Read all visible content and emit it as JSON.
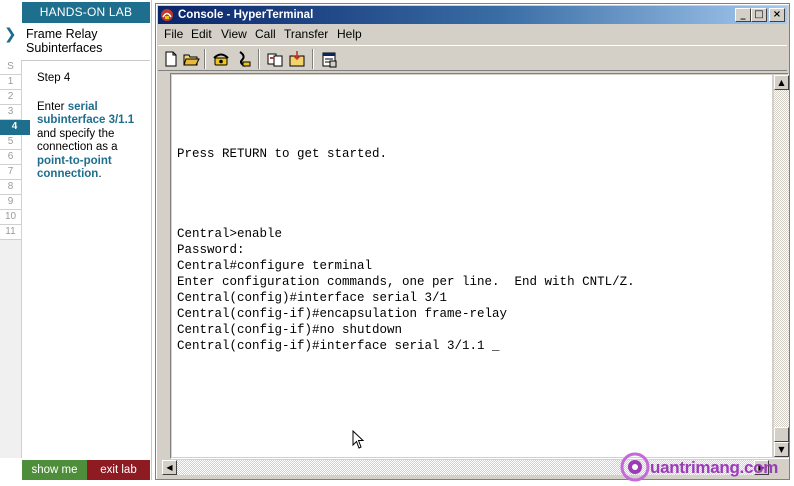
{
  "lab": {
    "header": "HANDS-ON LAB",
    "title": "Frame Relay Subinterfaces",
    "steps": [
      "S",
      "1",
      "2",
      "3",
      "4",
      "5",
      "6",
      "7",
      "8",
      "9",
      "10",
      "11"
    ],
    "active_step": "4",
    "step_label": "Step 4",
    "instruction": {
      "part1": "Enter ",
      "highlight1": "serial subinterface 3/1.1",
      "part2": " and specify the connection as a ",
      "highlight2": "point-to-point connection",
      "part3": "."
    },
    "buttons": {
      "show_me": "show me",
      "exit_lab": "exit lab"
    },
    "colors": {
      "accent": "#1e6e8e",
      "show_me": "#4e8e3a",
      "exit_lab": "#8e1a22"
    }
  },
  "window": {
    "title": "Console - HyperTerminal",
    "menu": [
      "File",
      "Edit",
      "View",
      "Call",
      "Transfer",
      "Help"
    ],
    "toolbar_icons": [
      "new-icon",
      "open-icon",
      "connect-icon",
      "disconnect-icon",
      "send-icon",
      "receive-icon",
      "properties-icon"
    ],
    "controls": {
      "minimize": "_",
      "maximize": "□",
      "close": "×"
    }
  },
  "terminal": {
    "lines": [
      {
        "row": 10,
        "text": "Press RETURN to get started."
      },
      {
        "row": 15,
        "text": "Central>enable"
      },
      {
        "row": 16,
        "text": "Password:"
      },
      {
        "row": 17,
        "text": "Central#configure terminal"
      },
      {
        "row": 18,
        "text": "Enter configuration commands, one per line.  End with CNTL/Z."
      },
      {
        "row": 19,
        "text": "Central(config)#interface serial 3/1"
      },
      {
        "row": 20,
        "text": "Central(config-if)#encapsulation frame-relay"
      },
      {
        "row": 21,
        "text": "Central(config-if)#no shutdown"
      },
      {
        "row": 22,
        "text": "Central(config-if)#interface serial 3/1.1 _"
      }
    ]
  },
  "watermark": {
    "text": "uantrimang.com"
  }
}
